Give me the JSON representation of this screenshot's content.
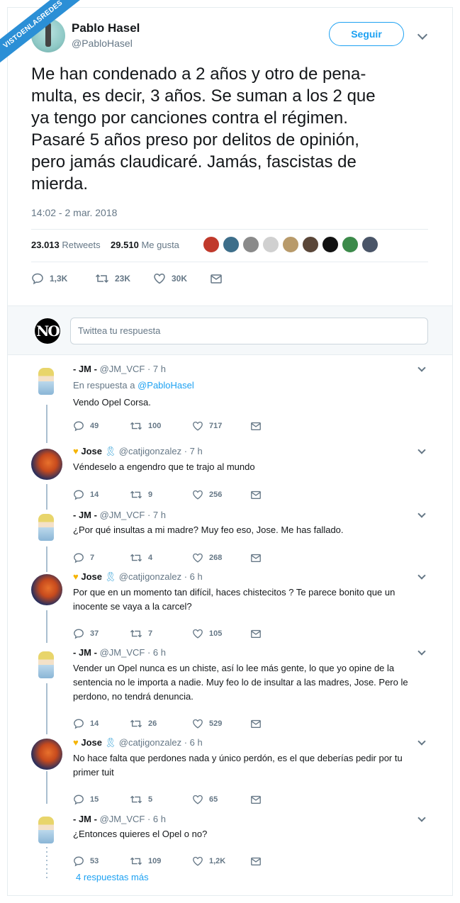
{
  "watermark": "VISTOENLASREDES",
  "main_tweet": {
    "author_name": "Pablo Hasel",
    "author_handle": "@PabloHasel",
    "follow_label": "Seguir",
    "text": "Me han condenado a 2 años y otro de pena-\nmulta, es decir, 3 años. Se suman a los 2 que\nya tengo por canciones contra el régimen.\nPasaré 5 años preso por delitos de opinión,\npero jamás claudicaré. Jamás, fascistas de\nmierda.",
    "timestamp": "14:02 - 2 mar. 2018",
    "retweets_count": "23.013",
    "retweets_label": "Retweets",
    "likes_count": "29.510",
    "likes_label": "Me gusta",
    "actions": {
      "replies": "1,3K",
      "retweets": "23K",
      "likes": "30K"
    }
  },
  "reply_box": {
    "placeholder": "Twittea tu respuesta"
  },
  "replies": [
    {
      "name": "- JM -",
      "handle": "@JM_VCF",
      "time": "· 7 h",
      "in_reply_prefix": "En respuesta a",
      "in_reply_handle": "@PabloHasel",
      "text": "Vendo Opel Corsa.",
      "replies": "49",
      "retweets": "100",
      "likes": "717"
    },
    {
      "name": "Jose",
      "handle": "@catjigonzalez",
      "time": "· 7 h",
      "text": "Véndeselo a engendro que te trajo al mundo",
      "replies": "14",
      "retweets": "9",
      "likes": "256"
    },
    {
      "name": "- JM -",
      "handle": "@JM_VCF",
      "time": "· 7 h",
      "text": "¿Por qué insultas a mi madre? Muy feo eso, Jose. Me has fallado.",
      "replies": "7",
      "retweets": "4",
      "likes": "268"
    },
    {
      "name": "Jose",
      "handle": "@catjigonzalez",
      "time": "· 6 h",
      "text": "Por que en un momento tan difícil, haces chistecitos ? Te parece bonito que un inocente se vaya a la carcel?",
      "replies": "37",
      "retweets": "7",
      "likes": "105"
    },
    {
      "name": "- JM -",
      "handle": "@JM_VCF",
      "time": "· 6 h",
      "text": "Vender un Opel nunca es un chiste, así lo lee más gente, lo que yo opine de la sentencia no le importa a nadie. Muy feo lo de insultar a las madres, Jose. Pero le perdono, no tendrá denuncia.",
      "replies": "14",
      "retweets": "26",
      "likes": "529"
    },
    {
      "name": "Jose",
      "handle": "@catjigonzalez",
      "time": "· 6 h",
      "text": "No hace falta que perdones nada y único perdón, es el que deberías pedir por tu primer tuit",
      "replies": "15",
      "retweets": "5",
      "likes": "65"
    },
    {
      "name": "- JM -",
      "handle": "@JM_VCF",
      "time": "· 6 h",
      "text": "¿Entonces quieres el Opel o no?",
      "replies": "53",
      "retweets": "109",
      "likes": "1,2K"
    }
  ],
  "more_replies": "4 respuestas más",
  "colors": {
    "accent": "#1da1f2",
    "muted": "#657786",
    "text": "#14171a"
  }
}
